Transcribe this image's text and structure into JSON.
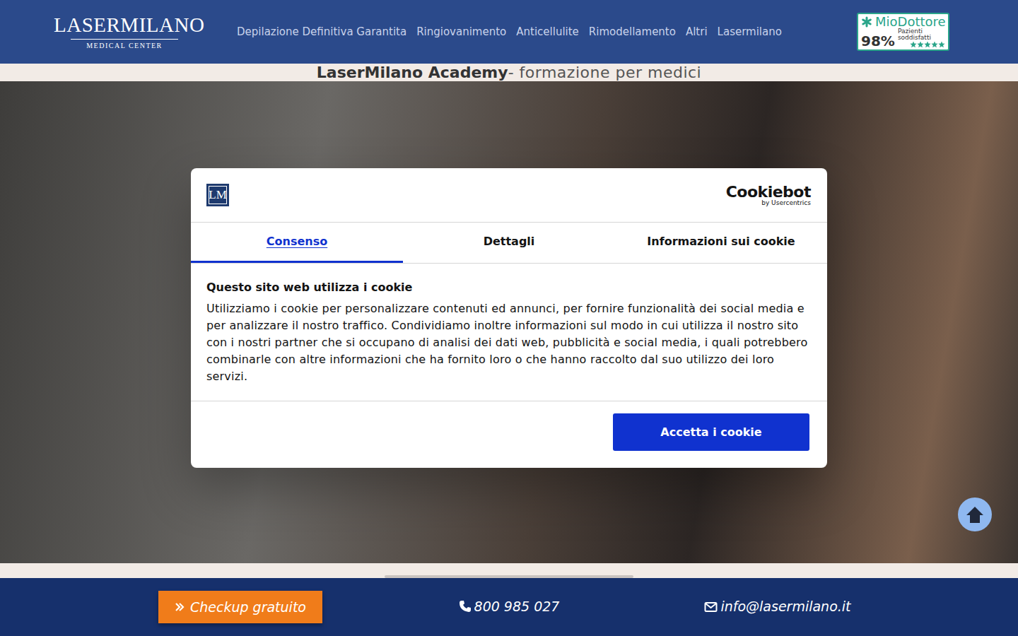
{
  "header": {
    "logo": {
      "title": "LASERMILANO",
      "subtitle": "MEDICAL CENTER"
    },
    "nav": [
      "Depilazione Definitiva Garantita",
      "Ringiovanimento",
      "Anticellulite",
      "Rimodellamento",
      "Altri",
      "Lasermilano"
    ],
    "badge": {
      "brand": "MioDottore",
      "percent": "98%",
      "caption": "Pazienti soddisfatti",
      "stars": 5
    }
  },
  "academy": {
    "bold": "LaserMilano Academy",
    "rest": "- formazione per medici"
  },
  "cookie_dialog": {
    "logo": "LM",
    "brand": "Cookiebot",
    "brand_sub": "by Usercentrics",
    "tabs": [
      {
        "label": "Consenso",
        "selected": true
      },
      {
        "label": "Dettagli",
        "selected": false
      },
      {
        "label": "Informazioni sui cookie",
        "selected": false
      }
    ],
    "title": "Questo sito web utilizza i cookie",
    "text": "Utilizziamo i cookie per personalizzare contenuti ed annunci, per fornire funzionalità dei social media e per analizzare il nostro traffico. Condividiamo inoltre informazioni sul modo in cui utilizza il nostro sito con i nostri partner che si occupano di analisi dei dati web, pubblicità e social media, i quali potrebbero combinarle con altre informazioni che ha fornito loro o che hanno raccolto dal suo utilizzo dei loro servizi.",
    "button": "Accetta i cookie"
  },
  "footer": {
    "checkup": "Checkup gratuito",
    "phone": "800 985 027",
    "email": "info@lasermilano.it"
  }
}
